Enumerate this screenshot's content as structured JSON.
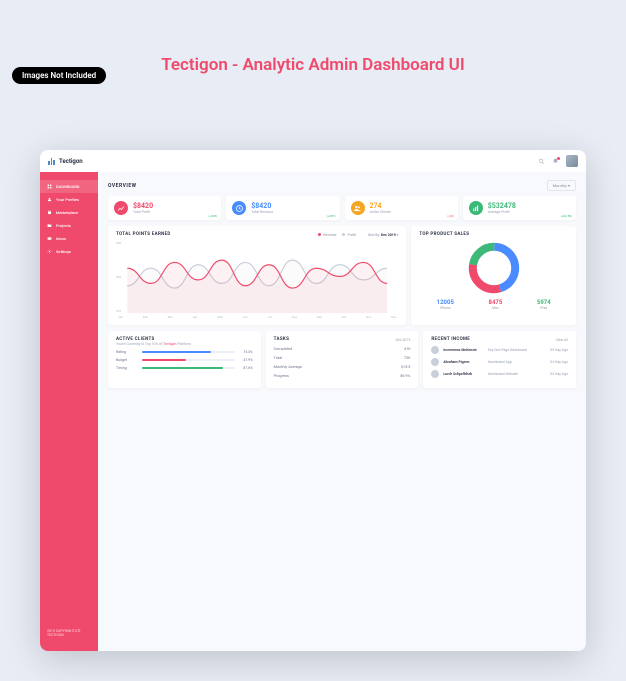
{
  "badge_top": "Images Not Included",
  "page_title": "Tectigon - Analytic Admin Dashboard UI",
  "brand": "Tectigon",
  "month_selector": "Monthly",
  "sort_label": "Sort By:",
  "sort_value": "Dec 2019",
  "sidebar": {
    "items": [
      {
        "label": "DASHBOARD"
      },
      {
        "label": "Your Profiles"
      },
      {
        "label": "Marketplace"
      },
      {
        "label": "Projects"
      },
      {
        "label": "Inbox"
      },
      {
        "label": "Settings"
      }
    ],
    "copyright": "2019 COPYRIGHTS © TECTIGON"
  },
  "overview_title": "OVERVIEW",
  "stats": [
    {
      "value": "$8420",
      "label": "Total Profit",
      "delta": "(+$25)",
      "color": "#ef4a6b",
      "dcolor": "#3cb878"
    },
    {
      "value": "$8420",
      "label": "Total Revenue",
      "delta": "(+387)",
      "color": "#4a8cff",
      "dcolor": "#3cb878"
    },
    {
      "value": "274",
      "label": "Active Clients",
      "delta": "(-29)",
      "color": "#f5a623",
      "dcolor": "#ef4a6b"
    },
    {
      "value": "$532478",
      "label": "Average Profit",
      "delta": "(+$3.50)",
      "color": "#3cb878",
      "dcolor": "#3cb878"
    }
  ],
  "chart_data": {
    "type": "line",
    "title": "TOTAL POINTS EARNED",
    "xlabel": "",
    "ylabel": "",
    "categories": [
      "Jan",
      "Feb",
      "Mar",
      "Apr",
      "May",
      "Jun",
      "Jul",
      "Aug",
      "Sep",
      "Oct",
      "Nov",
      "Dec"
    ],
    "yticks": [
      "$50",
      "$30",
      "$10"
    ],
    "ylim": [
      0,
      55
    ],
    "series": [
      {
        "name": "Revenue",
        "color": "#ef4a6b",
        "values": [
          35,
          22,
          40,
          25,
          42,
          20,
          38,
          18,
          35,
          28,
          40,
          22
        ]
      },
      {
        "name": "Profit",
        "color": "#c8ceda",
        "values": [
          20,
          35,
          18,
          38,
          22,
          40,
          20,
          42,
          22,
          38,
          25,
          35
        ]
      }
    ],
    "legend": [
      "Revenue",
      "Profit"
    ]
  },
  "donut": {
    "title": "TOP PRODUCT SALES",
    "data": [
      {
        "name": "iPhone",
        "value": 12005,
        "color": "#4a8cff"
      },
      {
        "name": "Mac",
        "value": 8475,
        "color": "#ef4a6b"
      },
      {
        "name": "iPad",
        "value": 5974,
        "color": "#3cb878"
      }
    ]
  },
  "active_clients": {
    "title": "ACTIVE CLIENTS",
    "subtitle_pre": "You're Currently in Top 10% of ",
    "subtitle_em": "Tectigon",
    "subtitle_post": " Platform",
    "bars": [
      {
        "label": "Rating",
        "pct": 74.3,
        "color": "#4a8cff"
      },
      {
        "label": "Budget",
        "pct": 47.9,
        "color": "#ef4a6b"
      },
      {
        "label": "Timing",
        "pct": 87.6,
        "color": "#3cb878"
      }
    ]
  },
  "tasks": {
    "title": "TASKS",
    "date": "Dec.2019",
    "rows": [
      {
        "label": "Completed",
        "value": "410"
      },
      {
        "label": "Total",
        "value": "720"
      },
      {
        "label": "Monthly Average",
        "value": "315.5"
      },
      {
        "label": "Progress",
        "value": "56.9%"
      }
    ]
  },
  "income": {
    "title": "RECENT INCOME",
    "viewall": "View All",
    "rows": [
      {
        "name": "Invereness McKenzie",
        "project": "Esy One Page Dashboard",
        "date": "05 Day Ago"
      },
      {
        "name": "Abraham Pigeon",
        "project": "Dashboard App",
        "date": "04 Day Ago"
      },
      {
        "name": "Lurch Schpellchek",
        "project": "Dashboard Website",
        "date": "03 Day Ago"
      }
    ]
  }
}
